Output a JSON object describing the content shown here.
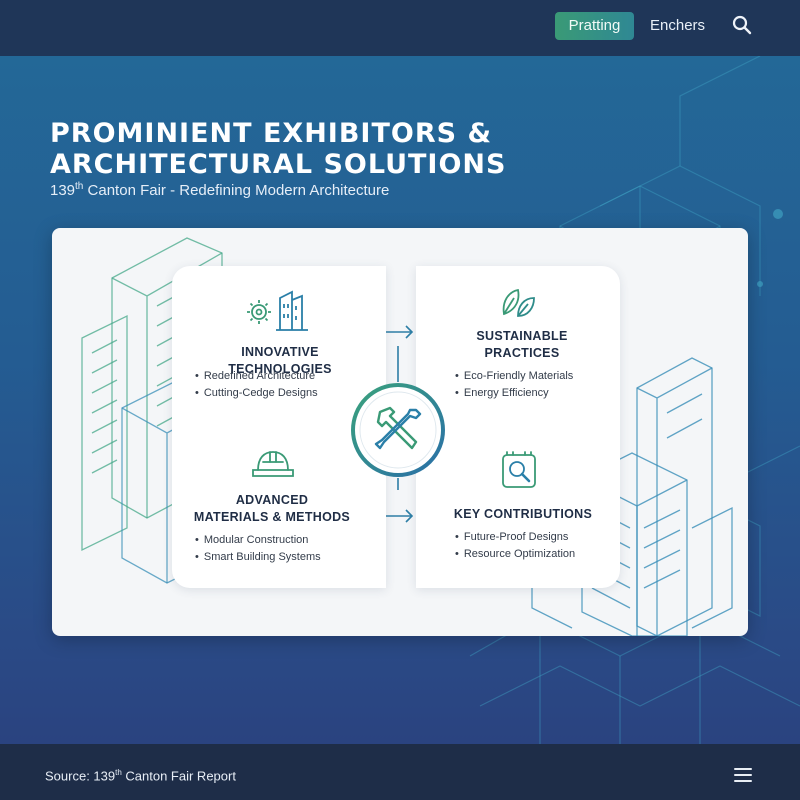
{
  "nav": {
    "active_tab": "Pratting",
    "link": "Enchers",
    "search_icon": "search-icon"
  },
  "hero": {
    "title": "PROMINIENT EXHIBITORS & ARCHITECTURAL SOLUTIONS",
    "subtitle_ordinal_number": "139",
    "subtitle_ordinal_suffix": "th",
    "subtitle_rest": " Canton Fair - Redefining Modern Architecture"
  },
  "sections": {
    "innovative": {
      "icon": "gear-building-icon",
      "title": "INNOVATIVE TECHNOLOGIES",
      "bullets": [
        "Redefined Architecture",
        "Cutting-Cedge Designs"
      ]
    },
    "sustainable": {
      "icon": "leaf-icon",
      "title_line1": "SUSTAINABLE",
      "title_line2": "PRACTICES",
      "bullets": [
        "Eco-Friendly Materials",
        "Energy Efficiency"
      ]
    },
    "materials": {
      "icon": "hard-hat-icon",
      "title_line1": "ADVANCED",
      "title_line2": "MATERIALS & METHODS",
      "bullets": [
        "Modular Construction",
        "Smart Building Systems"
      ]
    },
    "contributions": {
      "icon": "magnifier-document-icon",
      "title": "KEY CONTRIBUTIONS",
      "bullets": [
        "Future-Proof Designs",
        "Resource Optimization"
      ]
    },
    "hub_icon": "wrench-screwdriver-icon"
  },
  "footer": {
    "source_prefix": "Source: 139",
    "source_suffix": "th",
    "source_rest": " Canton Fair Report",
    "menu_icon": "hamburger-menu-icon"
  },
  "colors": {
    "accent_green": "#3a9a76",
    "accent_blue": "#2a7fa8",
    "topbar": "#1f3658",
    "footer": "#1e2d48"
  }
}
